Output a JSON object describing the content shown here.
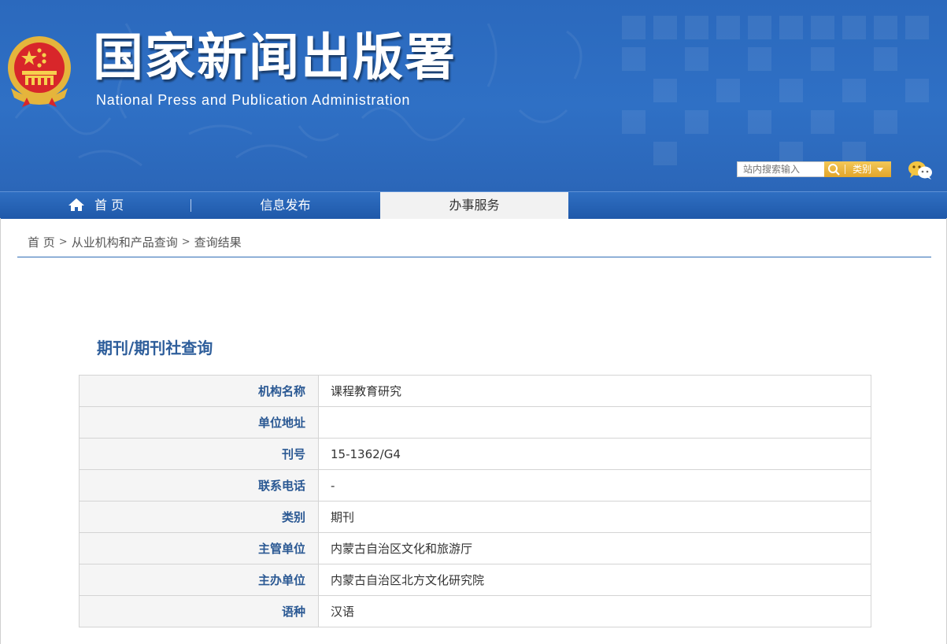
{
  "header": {
    "cn_title": "国家新闻出版署",
    "en_title": "National  Press and Publication Administration",
    "search": {
      "placeholder": "站内搜索输入",
      "category_label": "类别"
    }
  },
  "nav": {
    "home": "首 页",
    "info": "信息发布",
    "service": "办事服务"
  },
  "breadcrumb": {
    "home": "首 页",
    "sep": ">",
    "level1": "从业机构和产品查询",
    "level2": "查询结果"
  },
  "page_title": "期刊/期刊社查询",
  "table": {
    "rows": [
      {
        "label": "机构名称",
        "value": "课程教育研究"
      },
      {
        "label": "单位地址",
        "value": ""
      },
      {
        "label": "刊号",
        "value": "15-1362/G4"
      },
      {
        "label": "联系电话",
        "value": "-"
      },
      {
        "label": "类别",
        "value": "期刊"
      },
      {
        "label": "主管单位",
        "value": "内蒙古自治区文化和旅游厅"
      },
      {
        "label": "主办单位",
        "value": "内蒙古自治区北方文化研究院"
      },
      {
        "label": "语种",
        "value": "汉语"
      }
    ]
  },
  "colors": {
    "header_blue": "#2f6ec4",
    "nav_blue": "#2a63b5",
    "accent_gold": "#e8b13a",
    "label_blue": "#2a5893"
  },
  "icons": [
    "national-emblem-icon",
    "search-icon",
    "dropdown-arrow-icon",
    "wechat-icon",
    "home-icon"
  ]
}
